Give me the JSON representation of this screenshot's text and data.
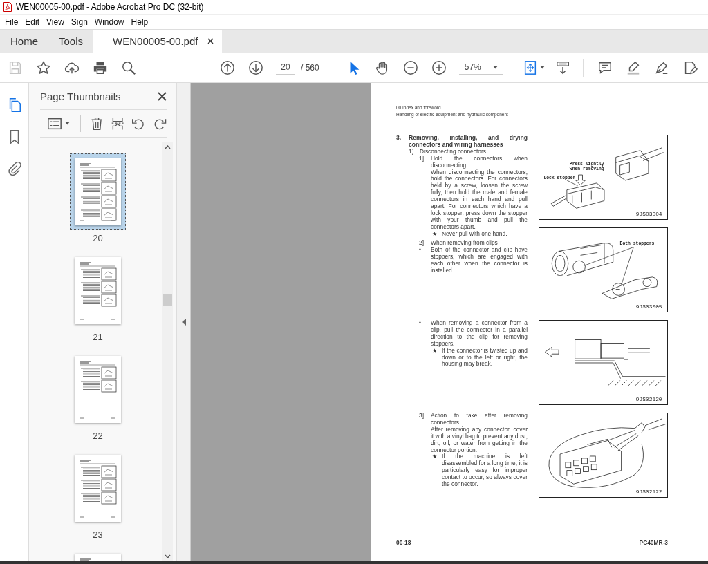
{
  "window": {
    "title": "WEN00005-00.pdf - Adobe Acrobat Pro DC (32-bit)"
  },
  "menu": [
    "File",
    "Edit",
    "View",
    "Sign",
    "Window",
    "Help"
  ],
  "tabs": [
    {
      "label": "Home",
      "selected": false,
      "closable": false
    },
    {
      "label": "Tools",
      "selected": false,
      "closable": false
    },
    {
      "label": "WEN00005-00.pdf",
      "selected": true,
      "closable": true
    }
  ],
  "toolbar": {
    "left_tools": [
      {
        "kind": "save",
        "disabled": true
      },
      {
        "kind": "star",
        "disabled": false
      },
      {
        "kind": "upload",
        "disabled": false
      },
      {
        "kind": "print",
        "disabled": false
      },
      {
        "kind": "find",
        "disabled": false
      }
    ],
    "page_nav": [
      {
        "kind": "up"
      },
      {
        "kind": "down"
      }
    ],
    "page_number": "20",
    "page_total": "/ 560",
    "tools": [
      {
        "kind": "select",
        "selected": true
      },
      {
        "kind": "hand",
        "selected": false
      }
    ],
    "zoom_buttons": [
      {
        "kind": "zoomout"
      },
      {
        "kind": "zoomin"
      }
    ],
    "zoom": "57%",
    "view_tools": [
      {
        "kind": "fit",
        "selected": true,
        "dropdown": true
      },
      {
        "kind": "scroll",
        "selected": false,
        "dropdown": false
      }
    ],
    "right_tools": [
      {
        "kind": "comment"
      },
      {
        "kind": "highlight"
      },
      {
        "kind": "sign"
      },
      {
        "kind": "edit"
      }
    ]
  },
  "rail": [
    {
      "kind": "pages",
      "selected": true
    },
    {
      "kind": "bookmarks",
      "selected": false
    },
    {
      "kind": "attachments",
      "selected": false
    }
  ],
  "thumbnail_panel": {
    "title": "Page Thumbnails",
    "tools": [
      {
        "kind": "options"
      },
      {
        "kind": "delete"
      },
      {
        "kind": "extract"
      },
      {
        "kind": "rotate_ccw"
      },
      {
        "kind": "rotate_cw"
      }
    ],
    "thumbnails": [
      {
        "label": "20",
        "selected": true
      },
      {
        "label": "21",
        "selected": false
      },
      {
        "label": "22",
        "selected": false
      },
      {
        "label": "23",
        "selected": false
      },
      {
        "selected": false
      }
    ]
  },
  "document": {
    "header": [
      "00 Index and foreword",
      "Handling of electric equipment and hydraulic component"
    ],
    "rows": [
      {
        "blocks": [
          {
            "kind": "heading",
            "marker": "3.",
            "text": "Removing, installing, and drying connectors and wiring harnesses"
          },
          {
            "kind": "sub",
            "marker": "1)",
            "text": "Disconnecting connectors"
          },
          {
            "kind": "step",
            "marker": "1]",
            "text": "Hold the connectors when disconnecting."
          },
          {
            "kind": "para",
            "text": "When disconnecting the connectors, hold the connectors. For connectors held by a screw, loosen the screw fully, then hold the male and female connectors in each hand and pull apart. For connectors which have a lock stopper, press down the stopper with your thumb and pull the connectors apart."
          },
          {
            "kind": "note",
            "marker": "★",
            "text": "Never pull with one hand."
          }
        ],
        "figure": {
          "kind": "connector_lock",
          "labels": [
            "Press lightly",
            "when removing",
            "Lock stopper"
          ],
          "code": "9JS03004"
        }
      },
      {
        "blocks": [
          {
            "kind": "step",
            "marker": "2]",
            "text": "When removing from clips"
          },
          {
            "kind": "bullet",
            "marker": "•",
            "text": "Both of the connector and clip have stoppers, which are engaged with each other when the connector is installed."
          }
        ],
        "figure": {
          "kind": "clip_stoppers",
          "labels": [
            "Both stoppers"
          ],
          "code": "9JS03005"
        }
      },
      {
        "blocks": [
          {
            "kind": "bullet",
            "marker": "•",
            "text": "When removing a connector from a clip, pull the connector in a parallel direction to the clip for removing stoppers."
          },
          {
            "kind": "note",
            "marker": "★",
            "text": "If the connector is twisted up and down or to the left or right, the housing may break."
          }
        ],
        "figure": {
          "kind": "clip_pull",
          "code": "9JS02120"
        }
      },
      {
        "blocks": [
          {
            "kind": "step",
            "marker": "3]",
            "text": "Action to take after removing connectors"
          },
          {
            "kind": "para",
            "text": "After removing any connector, cover it with a vinyl bag to prevent any dust, dirt, oil, or water from getting in the connector portion."
          },
          {
            "kind": "note",
            "marker": "★",
            "text": "If the machine is left disassembled for a long time, it is particularly easy for improper contact to occur, so always cover the connector."
          }
        ],
        "figure": {
          "kind": "vinyl_bag",
          "code": "9JS02122"
        }
      }
    ],
    "footer": {
      "left": "00-18",
      "right": "PC40MR-3"
    }
  }
}
